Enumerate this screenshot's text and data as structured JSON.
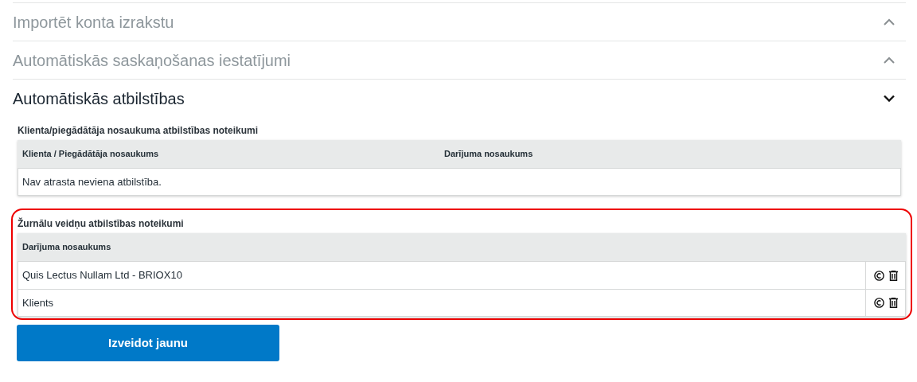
{
  "sections": [
    {
      "title": "Importēt konta izrakstu",
      "expanded": false
    },
    {
      "title": "Automātiskās saskaņošanas iestatījumi",
      "expanded": false
    },
    {
      "title": "Automātiskās atbilstības",
      "expanded": true
    }
  ],
  "rule_tables": [
    {
      "title": "Klienta/piegādātāja nosaukuma atbilstības noteikumi",
      "highlighted": false,
      "columns": [
        "Klienta / Piegādātāja nosaukums",
        "Darījuma nosaukums"
      ],
      "empty_message": "Nav atrasta neviena atbilstība."
    },
    {
      "title": "Žurnālu veidņu atbilstības noteikumi",
      "highlighted": true,
      "columns": [
        "Darījuma nosaukums"
      ],
      "rows": [
        {
          "name": "Quis Lectus Nullam Ltd - BRIOX10"
        },
        {
          "name": "Klients"
        }
      ]
    }
  ],
  "create_button": "Izveidot jaunu"
}
